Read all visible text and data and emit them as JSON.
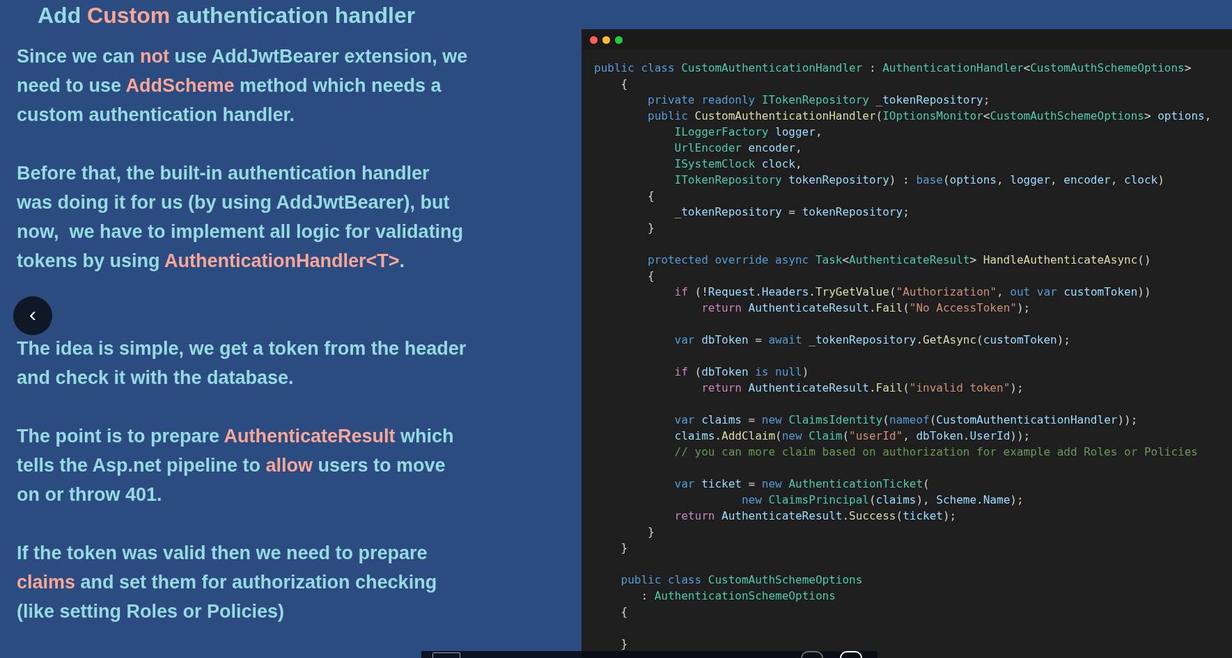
{
  "title": [
    {
      "text": "Add ",
      "highlight": false
    },
    {
      "text": "Custom",
      "highlight": true
    },
    {
      "text": " authentication handler",
      "highlight": false
    }
  ],
  "paragraphs": [
    [
      [
        {
          "text": "Since we can ",
          "highlight": false
        },
        {
          "text": "not",
          "highlight": true
        },
        {
          "text": " use AddJwtBearer extension, we",
          "highlight": false
        }
      ],
      [
        {
          "text": "need to use ",
          "highlight": false
        },
        {
          "text": "AddScheme",
          "highlight": true
        },
        {
          "text": " method which needs a",
          "highlight": false
        }
      ],
      [
        {
          "text": "custom authentication handler.",
          "highlight": false
        }
      ]
    ],
    [
      [
        {
          "text": "Before that, the built-in authentication handler",
          "highlight": false
        }
      ],
      [
        {
          "text": "was doing it for us (by using AddJwtBearer), but",
          "highlight": false
        }
      ],
      [
        {
          "text": "now,  we have to implement all logic for validating",
          "highlight": false
        }
      ],
      [
        {
          "text": "tokens by using ",
          "highlight": false
        },
        {
          "text": "AuthenticationHandler<T>",
          "highlight": true
        },
        {
          "text": ".",
          "highlight": false
        }
      ]
    ],
    [
      [
        {
          "text": "The idea is simple, we get a token from the header",
          "highlight": false
        }
      ],
      [
        {
          "text": "and check it with the database.",
          "highlight": false
        }
      ]
    ],
    [
      [
        {
          "text": "The point is to prepare ",
          "highlight": false
        },
        {
          "text": "AuthenticateResult",
          "highlight": true
        },
        {
          "text": " which",
          "highlight": false
        }
      ],
      [
        {
          "text": "tells the Asp.net pipeline to ",
          "highlight": false
        },
        {
          "text": "allow",
          "highlight": true
        },
        {
          "text": " users to move",
          "highlight": false
        }
      ],
      [
        {
          "text": "on or throw 401.",
          "highlight": false
        }
      ]
    ],
    [
      [
        {
          "text": "If the token was valid then we need to prepare",
          "highlight": false
        }
      ],
      [
        {
          "text": "claims",
          "highlight": true
        },
        {
          "text": " and set them for authorization checking",
          "highlight": false
        }
      ],
      [
        {
          "text": "(like setting Roles or Policies)",
          "highlight": false
        }
      ]
    ]
  ],
  "prev_button": "‹",
  "code": [
    {
      "kind": "code",
      "tokens": [
        {
          "kind": "keyword",
          "text": "public class "
        },
        {
          "kind": "type",
          "text": "CustomAuthenticationHandler"
        },
        {
          "kind": "plain",
          "text": " : "
        },
        {
          "kind": "type",
          "text": "AuthenticationHandler"
        },
        {
          "kind": "plain",
          "text": "<"
        },
        {
          "kind": "type",
          "text": "CustomAuthSchemeOptions"
        },
        {
          "kind": "plain",
          "text": ">"
        }
      ]
    },
    {
      "kind": "code",
      "tokens": [
        {
          "kind": "plain",
          "text": "    {"
        }
      ]
    },
    {
      "kind": "code",
      "tokens": [
        {
          "kind": "keyword",
          "text": "        private readonly "
        },
        {
          "kind": "type",
          "text": "ITokenRepository"
        },
        {
          "kind": "ident",
          "text": " _tokenRepository"
        },
        {
          "kind": "plain",
          "text": ";"
        }
      ]
    },
    {
      "kind": "code",
      "tokens": [
        {
          "kind": "keyword",
          "text": "        public "
        },
        {
          "kind": "method",
          "text": "CustomAuthenticationHandler"
        },
        {
          "kind": "plain",
          "text": "("
        },
        {
          "kind": "type",
          "text": "IOptionsMonitor"
        },
        {
          "kind": "plain",
          "text": "<"
        },
        {
          "kind": "type",
          "text": "CustomAuthSchemeOptions"
        },
        {
          "kind": "plain",
          "text": ">"
        },
        {
          "kind": "ident",
          "text": " options"
        },
        {
          "kind": "plain",
          "text": ","
        }
      ]
    },
    {
      "kind": "code",
      "tokens": [
        {
          "kind": "type",
          "text": "            ILoggerFactory"
        },
        {
          "kind": "ident",
          "text": " logger"
        },
        {
          "kind": "plain",
          "text": ","
        }
      ]
    },
    {
      "kind": "code",
      "tokens": [
        {
          "kind": "type",
          "text": "            UrlEncoder"
        },
        {
          "kind": "ident",
          "text": " encoder"
        },
        {
          "kind": "plain",
          "text": ","
        }
      ]
    },
    {
      "kind": "code",
      "tokens": [
        {
          "kind": "type",
          "text": "            ISystemClock"
        },
        {
          "kind": "ident",
          "text": " clock"
        },
        {
          "kind": "plain",
          "text": ","
        }
      ]
    },
    {
      "kind": "code",
      "tokens": [
        {
          "kind": "type",
          "text": "            ITokenRepository"
        },
        {
          "kind": "ident",
          "text": " tokenRepository"
        },
        {
          "kind": "plain",
          "text": ") : "
        },
        {
          "kind": "keyword",
          "text": "base"
        },
        {
          "kind": "plain",
          "text": "("
        },
        {
          "kind": "ident",
          "text": "options"
        },
        {
          "kind": "plain",
          "text": ", "
        },
        {
          "kind": "ident",
          "text": "logger"
        },
        {
          "kind": "plain",
          "text": ", "
        },
        {
          "kind": "ident",
          "text": "encoder"
        },
        {
          "kind": "plain",
          "text": ", "
        },
        {
          "kind": "ident",
          "text": "clock"
        },
        {
          "kind": "plain",
          "text": ")"
        }
      ]
    },
    {
      "kind": "code",
      "tokens": [
        {
          "kind": "plain",
          "text": "        {"
        }
      ]
    },
    {
      "kind": "code",
      "tokens": [
        {
          "kind": "ident",
          "text": "            _tokenRepository"
        },
        {
          "kind": "plain",
          "text": " = "
        },
        {
          "kind": "ident",
          "text": "tokenRepository"
        },
        {
          "kind": "plain",
          "text": ";"
        }
      ]
    },
    {
      "kind": "code",
      "tokens": [
        {
          "kind": "plain",
          "text": "        }"
        }
      ]
    },
    {
      "kind": "blank"
    },
    {
      "kind": "code",
      "tokens": [
        {
          "kind": "keyword",
          "text": "        protected override async "
        },
        {
          "kind": "type",
          "text": "Task"
        },
        {
          "kind": "plain",
          "text": "<"
        },
        {
          "kind": "type",
          "text": "AuthenticateResult"
        },
        {
          "kind": "plain",
          "text": "> "
        },
        {
          "kind": "method",
          "text": "HandleAuthenticateAsync"
        },
        {
          "kind": "plain",
          "text": "()"
        }
      ]
    },
    {
      "kind": "code",
      "tokens": [
        {
          "kind": "plain",
          "text": "        {"
        }
      ]
    },
    {
      "kind": "code",
      "tokens": [
        {
          "kind": "control",
          "text": "            if"
        },
        {
          "kind": "plain",
          "text": " (!"
        },
        {
          "kind": "ident",
          "text": "Request"
        },
        {
          "kind": "plain",
          "text": "."
        },
        {
          "kind": "ident",
          "text": "Headers"
        },
        {
          "kind": "plain",
          "text": "."
        },
        {
          "kind": "method",
          "text": "TryGetValue"
        },
        {
          "kind": "plain",
          "text": "("
        },
        {
          "kind": "string",
          "text": "\"Authorization\""
        },
        {
          "kind": "plain",
          "text": ", "
        },
        {
          "kind": "keyword",
          "text": "out var"
        },
        {
          "kind": "ident",
          "text": " customToken"
        },
        {
          "kind": "plain",
          "text": "))"
        }
      ]
    },
    {
      "kind": "code",
      "tokens": [
        {
          "kind": "control",
          "text": "                return"
        },
        {
          "kind": "ident",
          "text": " AuthenticateResult"
        },
        {
          "kind": "plain",
          "text": "."
        },
        {
          "kind": "method",
          "text": "Fail"
        },
        {
          "kind": "plain",
          "text": "("
        },
        {
          "kind": "string",
          "text": "\"No AccessToken\""
        },
        {
          "kind": "plain",
          "text": ");"
        }
      ]
    },
    {
      "kind": "blank"
    },
    {
      "kind": "code",
      "tokens": [
        {
          "kind": "keyword",
          "text": "            var"
        },
        {
          "kind": "ident",
          "text": " dbToken"
        },
        {
          "kind": "plain",
          "text": " = "
        },
        {
          "kind": "keyword",
          "text": "await"
        },
        {
          "kind": "ident",
          "text": " _tokenRepository"
        },
        {
          "kind": "plain",
          "text": "."
        },
        {
          "kind": "method",
          "text": "GetAsync"
        },
        {
          "kind": "plain",
          "text": "("
        },
        {
          "kind": "ident",
          "text": "customToken"
        },
        {
          "kind": "plain",
          "text": ");"
        }
      ]
    },
    {
      "kind": "blank"
    },
    {
      "kind": "code",
      "tokens": [
        {
          "kind": "control",
          "text": "            if"
        },
        {
          "kind": "plain",
          "text": " ("
        },
        {
          "kind": "ident",
          "text": "dbToken"
        },
        {
          "kind": "keyword",
          "text": " is null"
        },
        {
          "kind": "plain",
          "text": ")"
        }
      ]
    },
    {
      "kind": "code",
      "tokens": [
        {
          "kind": "control",
          "text": "                return"
        },
        {
          "kind": "ident",
          "text": " AuthenticateResult"
        },
        {
          "kind": "plain",
          "text": "."
        },
        {
          "kind": "method",
          "text": "Fail"
        },
        {
          "kind": "plain",
          "text": "("
        },
        {
          "kind": "string",
          "text": "\"invalid token\""
        },
        {
          "kind": "plain",
          "text": ");"
        }
      ]
    },
    {
      "kind": "blank"
    },
    {
      "kind": "code",
      "tokens": [
        {
          "kind": "keyword",
          "text": "            var"
        },
        {
          "kind": "ident",
          "text": " claims"
        },
        {
          "kind": "plain",
          "text": " = "
        },
        {
          "kind": "keyword",
          "text": "new "
        },
        {
          "kind": "type",
          "text": "ClaimsIdentity"
        },
        {
          "kind": "plain",
          "text": "("
        },
        {
          "kind": "keyword",
          "text": "nameof"
        },
        {
          "kind": "plain",
          "text": "("
        },
        {
          "kind": "ident",
          "text": "CustomAuthenticationHandler"
        },
        {
          "kind": "plain",
          "text": "));"
        }
      ]
    },
    {
      "kind": "code",
      "tokens": [
        {
          "kind": "ident",
          "text": "            claims"
        },
        {
          "kind": "plain",
          "text": "."
        },
        {
          "kind": "method",
          "text": "AddClaim"
        },
        {
          "kind": "plain",
          "text": "("
        },
        {
          "kind": "keyword",
          "text": "new "
        },
        {
          "kind": "type",
          "text": "Claim"
        },
        {
          "kind": "plain",
          "text": "("
        },
        {
          "kind": "string",
          "text": "\"userId\""
        },
        {
          "kind": "plain",
          "text": ", "
        },
        {
          "kind": "ident",
          "text": "dbToken"
        },
        {
          "kind": "plain",
          "text": "."
        },
        {
          "kind": "ident",
          "text": "UserId"
        },
        {
          "kind": "plain",
          "text": "));"
        }
      ]
    },
    {
      "kind": "code",
      "tokens": [
        {
          "kind": "comment",
          "text": "            // you can more claim based on authorization for example add Roles or Policies"
        }
      ]
    },
    {
      "kind": "blank"
    },
    {
      "kind": "code",
      "tokens": [
        {
          "kind": "keyword",
          "text": "            var"
        },
        {
          "kind": "ident",
          "text": " ticket"
        },
        {
          "kind": "plain",
          "text": " = "
        },
        {
          "kind": "keyword",
          "text": "new "
        },
        {
          "kind": "type",
          "text": "AuthenticationTicket"
        },
        {
          "kind": "plain",
          "text": "("
        }
      ]
    },
    {
      "kind": "code",
      "tokens": [
        {
          "kind": "keyword",
          "text": "                      new "
        },
        {
          "kind": "type",
          "text": "ClaimsPrincipal"
        },
        {
          "kind": "plain",
          "text": "("
        },
        {
          "kind": "ident",
          "text": "claims"
        },
        {
          "kind": "plain",
          "text": "), "
        },
        {
          "kind": "ident",
          "text": "Scheme"
        },
        {
          "kind": "plain",
          "text": "."
        },
        {
          "kind": "ident",
          "text": "Name"
        },
        {
          "kind": "plain",
          "text": ");"
        }
      ]
    },
    {
      "kind": "code",
      "tokens": [
        {
          "kind": "control",
          "text": "            return"
        },
        {
          "kind": "ident",
          "text": " AuthenticateResult"
        },
        {
          "kind": "plain",
          "text": "."
        },
        {
          "kind": "method",
          "text": "Success"
        },
        {
          "kind": "plain",
          "text": "("
        },
        {
          "kind": "ident",
          "text": "ticket"
        },
        {
          "kind": "plain",
          "text": ");"
        }
      ]
    },
    {
      "kind": "code",
      "tokens": [
        {
          "kind": "plain",
          "text": "        }"
        }
      ]
    },
    {
      "kind": "code",
      "tokens": [
        {
          "kind": "plain",
          "text": "    }"
        }
      ]
    },
    {
      "kind": "blank"
    },
    {
      "kind": "code",
      "tokens": [
        {
          "kind": "keyword",
          "text": "    public class "
        },
        {
          "kind": "type",
          "text": "CustomAuthSchemeOptions"
        }
      ]
    },
    {
      "kind": "code",
      "tokens": [
        {
          "kind": "plain",
          "text": "       : "
        },
        {
          "kind": "type",
          "text": "AuthenticationSchemeOptions"
        }
      ]
    },
    {
      "kind": "code",
      "tokens": [
        {
          "kind": "plain",
          "text": "    {"
        }
      ]
    },
    {
      "kind": "blank"
    },
    {
      "kind": "code",
      "tokens": [
        {
          "kind": "plain",
          "text": "    }"
        }
      ]
    }
  ]
}
